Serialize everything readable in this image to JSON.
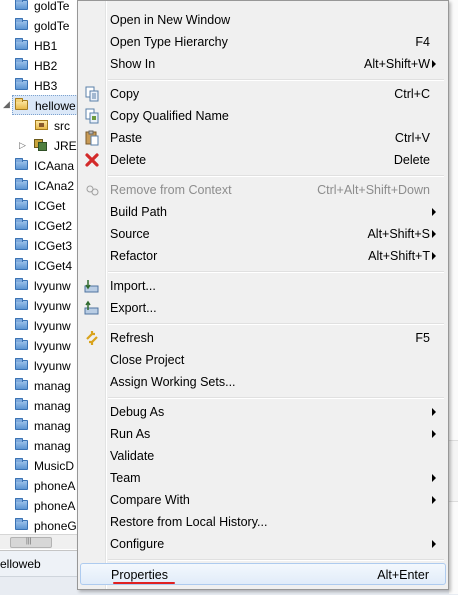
{
  "explorer": {
    "items": [
      {
        "label": "goldTe"
      },
      {
        "label": "goldTe"
      },
      {
        "label": "HB1"
      },
      {
        "label": "HB2"
      },
      {
        "label": "HB3"
      },
      {
        "label": "hellowe"
      },
      {
        "label": "src"
      },
      {
        "label": "JRE"
      },
      {
        "label": "ICAana"
      },
      {
        "label": "ICAna2"
      },
      {
        "label": "ICGet"
      },
      {
        "label": "ICGet2"
      },
      {
        "label": "ICGet3"
      },
      {
        "label": "ICGet4"
      },
      {
        "label": "lvyunw"
      },
      {
        "label": "lvyunw"
      },
      {
        "label": "lvyunw"
      },
      {
        "label": "lvyunw"
      },
      {
        "label": "lvyunw"
      },
      {
        "label": "manag"
      },
      {
        "label": "manag"
      },
      {
        "label": "manag"
      },
      {
        "label": "manag"
      },
      {
        "label": "MusicD"
      },
      {
        "label": "phoneA"
      },
      {
        "label": "phoneA"
      },
      {
        "label": "phoneG"
      }
    ],
    "status_tab_label": "elloweb"
  },
  "menu": {
    "items": [
      {
        "label": "Open in New Window",
        "accel": ""
      },
      {
        "label": "Open Type Hierarchy",
        "accel": "F4"
      },
      {
        "label": "Show In",
        "accel": "Alt+Shift+W"
      },
      {
        "label": "Copy",
        "accel": "Ctrl+C",
        "icon": "copy-icon"
      },
      {
        "label": "Copy Qualified Name",
        "accel": "",
        "icon": "copy-qualified-name-icon"
      },
      {
        "label": "Paste",
        "accel": "Ctrl+V",
        "icon": "paste-icon"
      },
      {
        "label": "Delete",
        "accel": "Delete",
        "icon": "delete-icon"
      },
      {
        "label": "Remove from Context",
        "accel": "Ctrl+Alt+Shift+Down",
        "icon": "remove-from-context-icon",
        "disabled": true
      },
      {
        "label": "Build Path",
        "accel": ""
      },
      {
        "label": "Source",
        "accel": "Alt+Shift+S"
      },
      {
        "label": "Refactor",
        "accel": "Alt+Shift+T"
      },
      {
        "label": "Import...",
        "accel": "",
        "icon": "import-icon"
      },
      {
        "label": "Export...",
        "accel": "",
        "icon": "export-icon"
      },
      {
        "label": "Refresh",
        "accel": "F5",
        "icon": "refresh-icon"
      },
      {
        "label": "Close Project",
        "accel": ""
      },
      {
        "label": "Assign Working Sets...",
        "accel": ""
      },
      {
        "label": "Debug As",
        "accel": ""
      },
      {
        "label": "Run As",
        "accel": ""
      },
      {
        "label": "Validate",
        "accel": ""
      },
      {
        "label": "Team",
        "accel": ""
      },
      {
        "label": "Compare With",
        "accel": ""
      },
      {
        "label": "Restore from Local History...",
        "accel": ""
      },
      {
        "label": "Configure",
        "accel": ""
      },
      {
        "label": "Properties",
        "accel": "Alt+Enter"
      }
    ],
    "colors": {
      "highlight_underline": "#e02020",
      "delete_icon": "#d32a2a"
    }
  }
}
